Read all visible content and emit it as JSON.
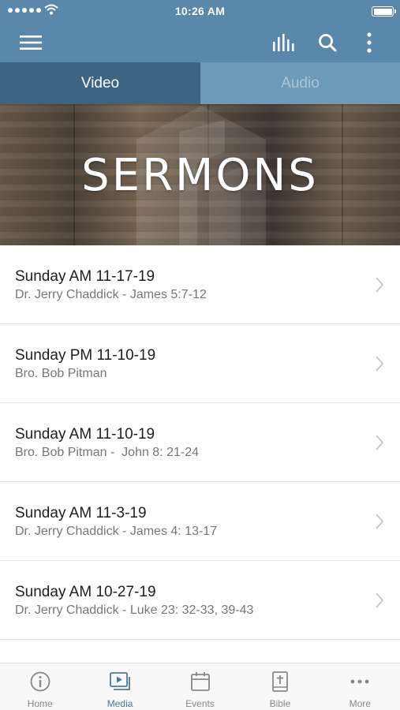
{
  "status_bar": {
    "time": "10:26 AM",
    "signal_icon": "signal-dots-icon",
    "wifi_icon": "wifi-icon",
    "battery_icon": "battery-icon"
  },
  "toolbar": {
    "menu_icon": "hamburger-menu-icon",
    "bars_icon": "audio-bars-icon",
    "search_icon": "search-icon",
    "more_icon": "vertical-dots-icon"
  },
  "tabs": [
    {
      "label": "Video",
      "active": true
    },
    {
      "label": "Audio",
      "active": false
    }
  ],
  "banner": {
    "title": "SERMONS"
  },
  "sermons": [
    {
      "title": "Sunday AM 11-17-19",
      "subtitle": "Dr. Jerry Chaddick - James 5:7-12"
    },
    {
      "title": "Sunday PM 11-10-19",
      "subtitle": "Bro. Bob Pitman"
    },
    {
      "title": "Sunday AM 11-10-19",
      "subtitle": "Bro. Bob Pitman -  John 8: 21-24"
    },
    {
      "title": "Sunday AM 11-3-19",
      "subtitle": "Dr. Jerry Chaddick - James 4: 13-17"
    },
    {
      "title": "Sunday AM 10-27-19",
      "subtitle": "Dr. Jerry Chaddick - Luke 23: 32-33, 39-43"
    }
  ],
  "bottom_nav": [
    {
      "label": "Home",
      "icon": "info-circle-icon",
      "active": false
    },
    {
      "label": "Media",
      "icon": "media-play-icon",
      "active": true
    },
    {
      "label": "Events",
      "icon": "calendar-icon",
      "active": false
    },
    {
      "label": "Bible",
      "icon": "bible-icon",
      "active": false
    },
    {
      "label": "More",
      "icon": "horizontal-dots-icon",
      "active": false
    }
  ],
  "colors": {
    "header": "#5a88aa",
    "tab_active": "#3d6583",
    "tab_inactive": "#6d9ab9",
    "nav_active": "#4a7a9c",
    "nav_inactive": "#888888"
  }
}
